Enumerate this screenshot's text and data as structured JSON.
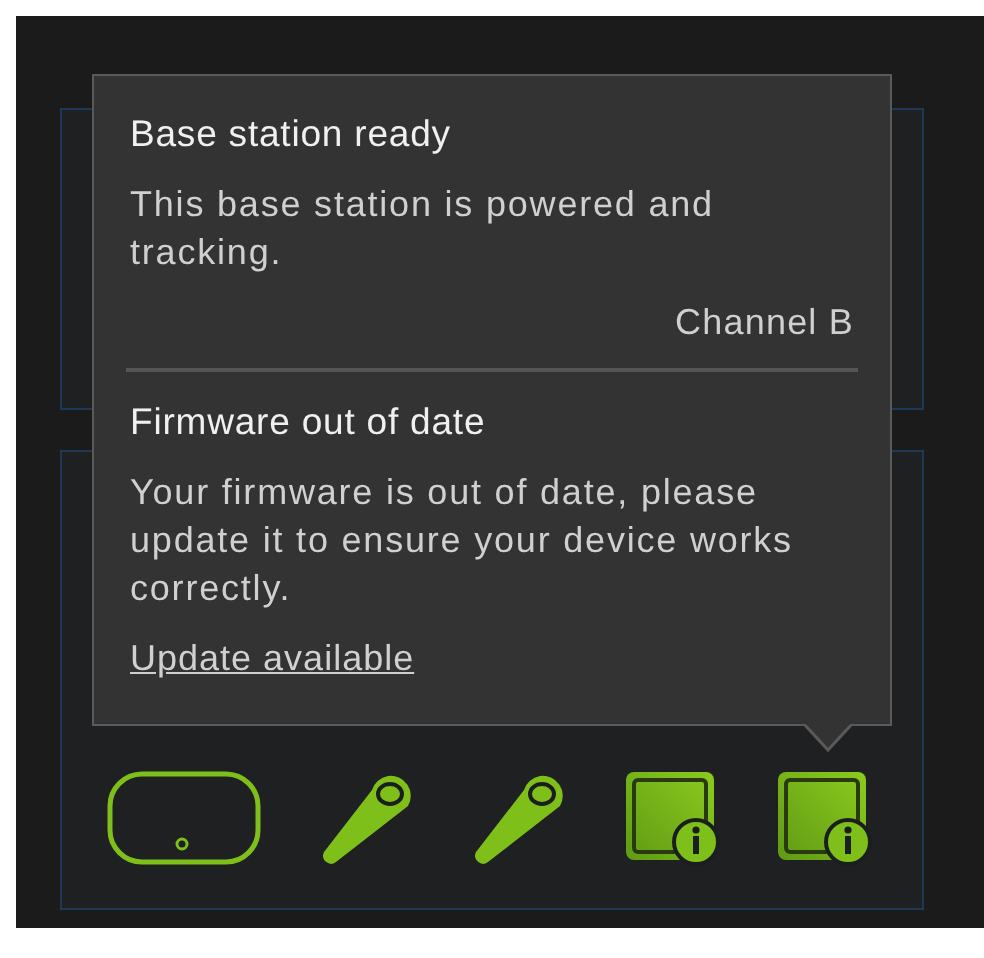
{
  "tooltip": {
    "sections": [
      {
        "title": "Base station ready",
        "body": "This base station is powered and tracking.",
        "detail": "Channel B"
      },
      {
        "title": "Firmware out of date",
        "body": "Your firmware is out of date, please update it to ensure your device works correctly.",
        "link": "Update available"
      }
    ]
  },
  "devices": [
    {
      "kind": "headset"
    },
    {
      "kind": "controller"
    },
    {
      "kind": "controller"
    },
    {
      "kind": "base_station"
    },
    {
      "kind": "base_station"
    }
  ]
}
